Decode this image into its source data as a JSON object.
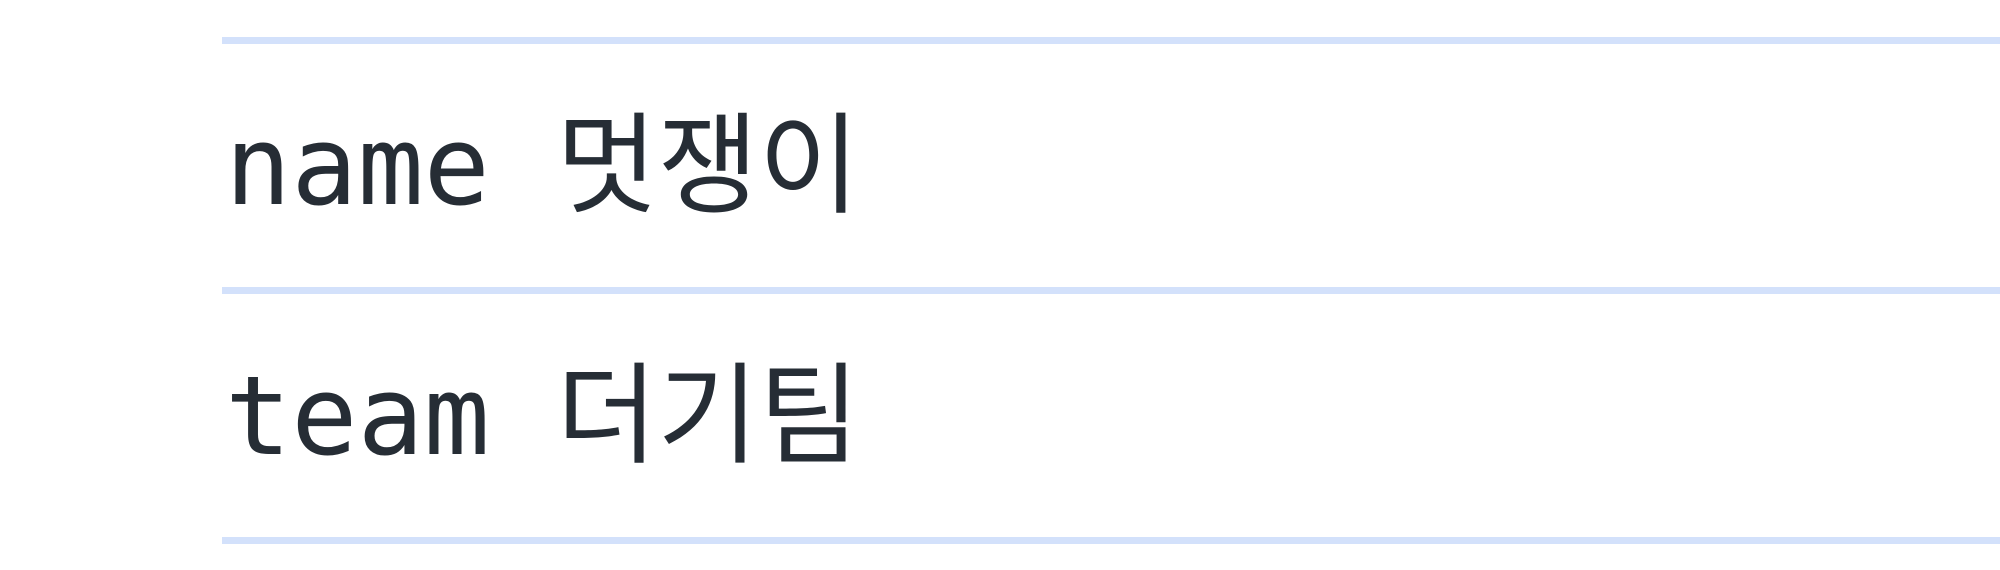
{
  "rows": [
    {
      "text": "name 멋쟁이"
    },
    {
      "text": "team 더기팀"
    }
  ],
  "colors": {
    "divider": "#d3e1fb",
    "text": "#262d35",
    "background": "#ffffff"
  }
}
